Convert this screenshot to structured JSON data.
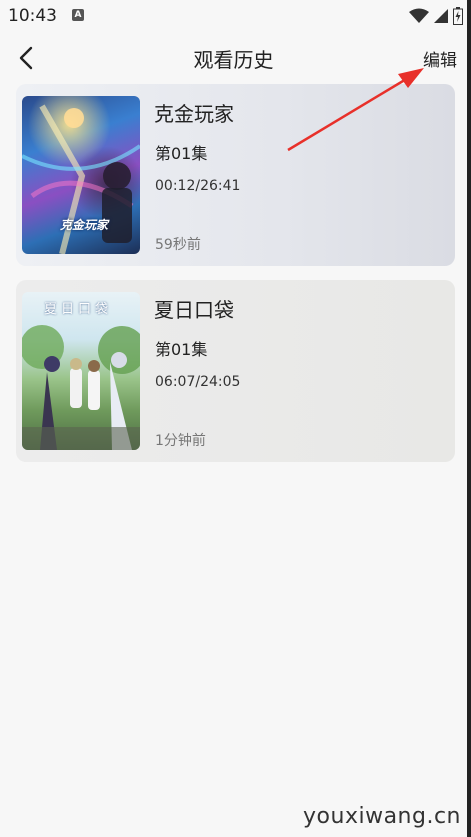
{
  "status_bar": {
    "time": "10:43",
    "notification_icon": "a-badge-icon",
    "right_icons": [
      "wifi-icon",
      "signal-icon",
      "battery-icon"
    ]
  },
  "header": {
    "title": "观看历史",
    "back_icon": "chevron-left-icon",
    "edit_label": "编辑"
  },
  "history": [
    {
      "title": "克金玩家",
      "episode": "第01集",
      "progress": "00:12/26:41",
      "time_ago": "59秒前",
      "cover_logo": "克金玩家"
    },
    {
      "title": "夏日口袋",
      "episode": "第01集",
      "progress": "06:07/24:05",
      "time_ago": "1分钟前",
      "cover_logo": "夏日口袋"
    }
  ],
  "annotation": {
    "arrow_color": "#e8302a"
  },
  "watermark": "youxiwang.cn"
}
